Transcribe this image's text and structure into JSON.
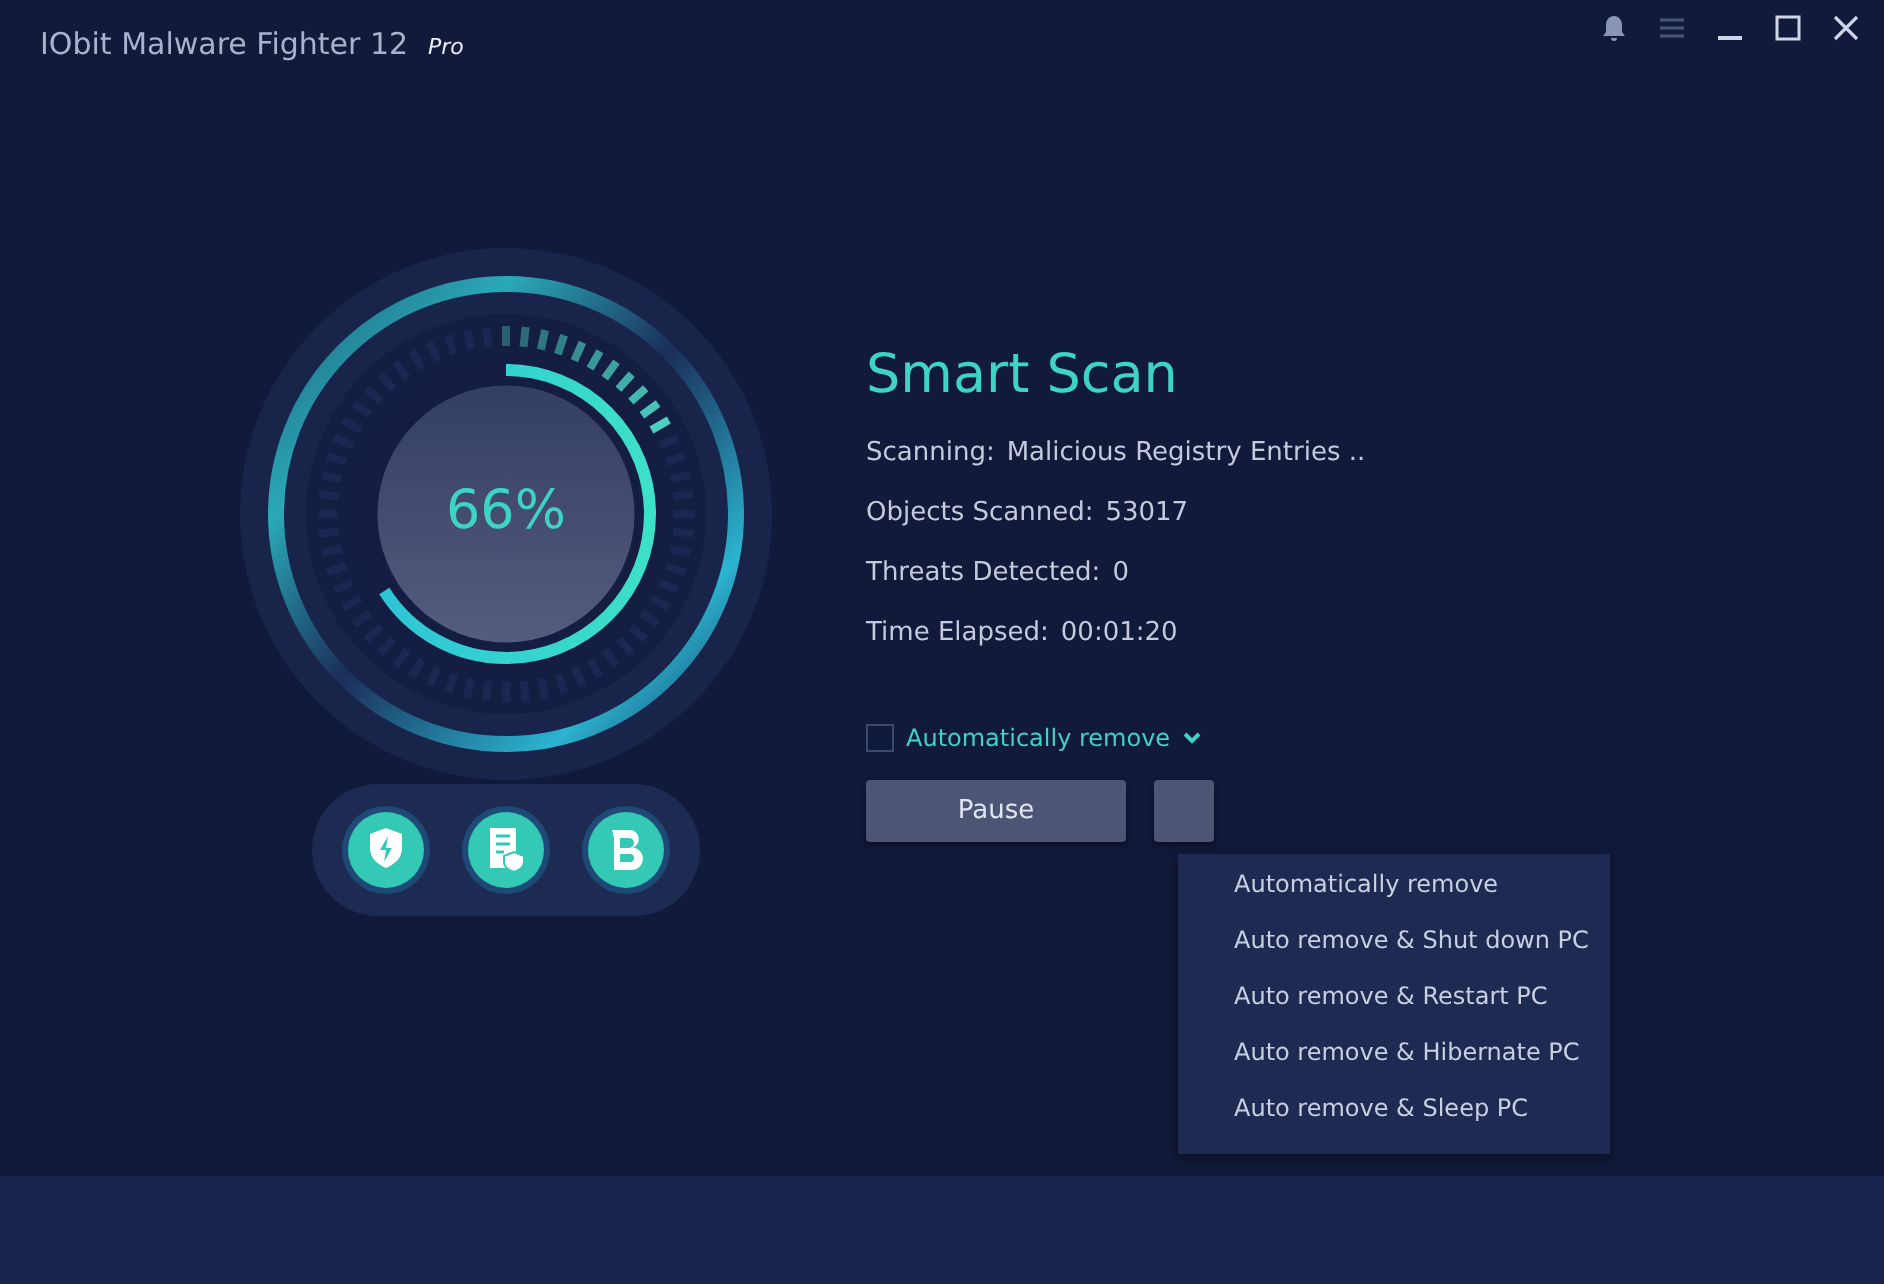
{
  "window": {
    "title": "IObit Malware Fighter 12",
    "edition": "Pro"
  },
  "scan": {
    "level": 0.66,
    "percent": "66%",
    "title": "Smart Scan",
    "details": [
      {
        "label": "Scanning:",
        "value": "Malicious Registry Entries .."
      },
      {
        "label": "Objects Scanned:",
        "value": "53017"
      },
      {
        "label": "Threats Detected:",
        "value": "0"
      },
      {
        "label": "Time Elapsed:",
        "value": "00:01:20"
      }
    ]
  },
  "auto_remove": {
    "label": "Automatically remove",
    "checked": false,
    "expanded": true
  },
  "buttons": [
    "Pause"
  ],
  "menu": [
    "Automatically remove",
    "Auto remove & Shut down PC",
    "Auto remove & Restart PC",
    "Auto remove & Hibernate PC",
    "Auto remove & Sleep PC"
  ]
}
